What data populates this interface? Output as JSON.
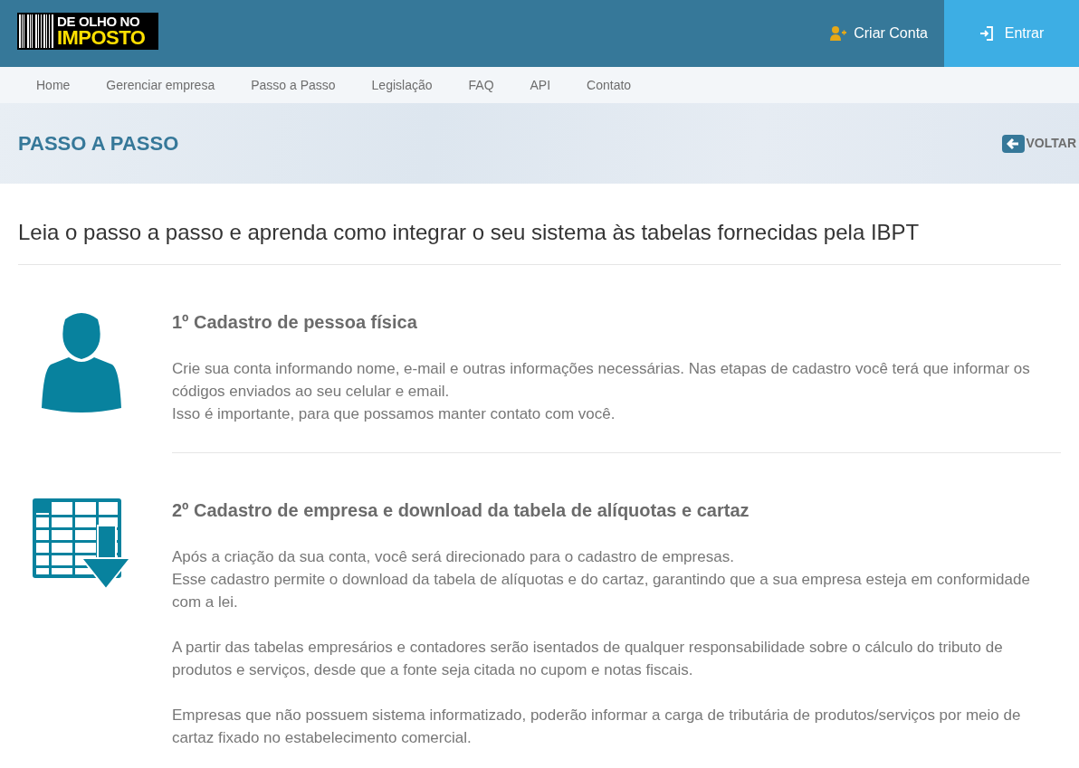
{
  "header": {
    "logo": {
      "line_1": "DE OLHO NO",
      "line_2": "IMPOSTO"
    },
    "actions": [
      {
        "label": "Criar Conta",
        "kind": "signup"
      },
      {
        "label": "Entrar",
        "kind": "login"
      }
    ]
  },
  "nav": [
    "Home",
    "Gerenciar empresa",
    "Passo a Passo",
    "Legislação",
    "FAQ",
    "API",
    "Contato"
  ],
  "banner": {
    "title": "PASSO A PASSO",
    "back": "VOLTAR"
  },
  "intro": "Leia o passo a passo e aprenda como integrar o seu sistema às tabelas fornecidas pela IBPT",
  "steps": [
    {
      "kind": "person",
      "title": "1º Cadastro de pessoa física",
      "paragraphs": [
        [
          "Crie sua conta informando nome, e-mail e outras informações necessárias. Nas etapas de cadastro você terá que informar os códigos enviados ao seu celular e email.",
          "Isso é importante, para que possamos manter contato com você."
        ]
      ]
    },
    {
      "kind": "table",
      "title": "2º Cadastro de empresa e download da tabela de alíquotas e cartaz",
      "paragraphs": [
        [
          "Após a criação da sua conta, você será direcionado para o cadastro de empresas.",
          "Esse cadastro permite o download da tabela de alíquotas e do cartaz, garantindo que a sua empresa esteja em conformidade com a lei."
        ],
        [
          "A partir das tabelas empresários e contadores serão isentados de qualquer responsabilidade sobre o cálculo do tributo de produtos e serviços, desde que a fonte seja citada no cupom e notas fiscais."
        ],
        [
          "Empresas que não possuem sistema informatizado, poderão informar a carga de tributária de produtos/serviços por meio de cartaz fixado no estabelecimento comercial."
        ]
      ]
    }
  ]
}
